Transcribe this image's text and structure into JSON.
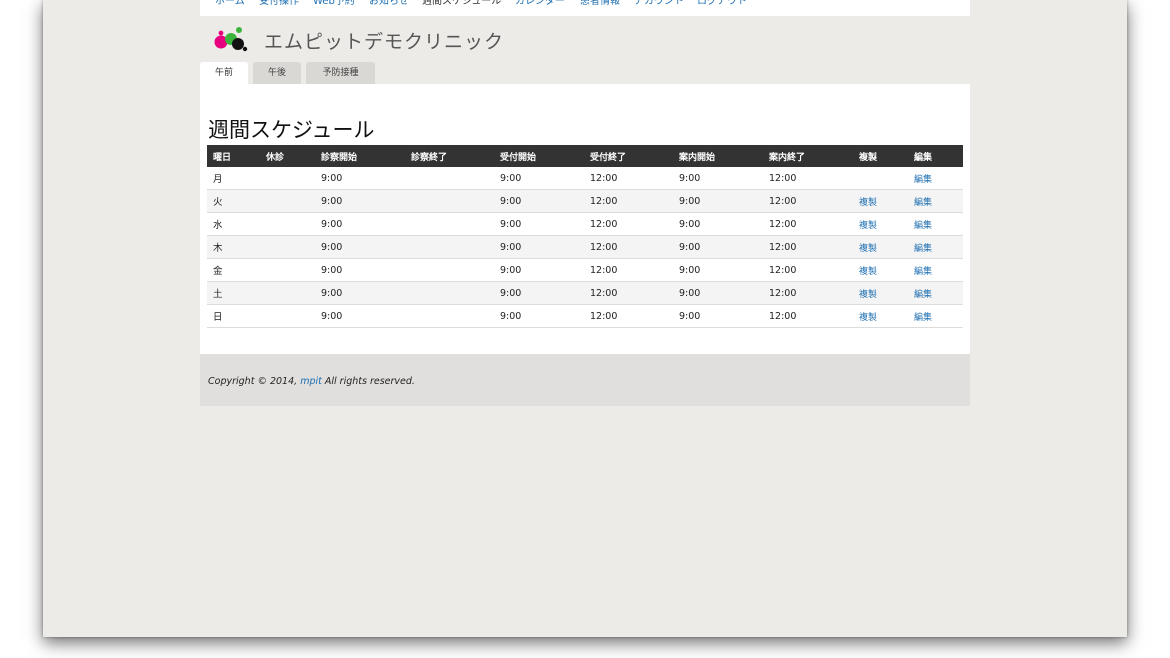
{
  "nav": {
    "items": [
      {
        "label": "ホーム",
        "current": false
      },
      {
        "label": "受付操作",
        "current": false
      },
      {
        "label": "Web予約",
        "current": false
      },
      {
        "label": "お知らせ",
        "current": false
      },
      {
        "label": "週間スケジュール",
        "current": true
      },
      {
        "label": "カレンダー",
        "current": false
      },
      {
        "label": "患者情報",
        "current": false
      },
      {
        "label": "アカウント",
        "current": false
      },
      {
        "label": "ログアウト",
        "current": false
      }
    ]
  },
  "header": {
    "brand": "エムピットデモクリニック"
  },
  "tabs": [
    {
      "label": "午前",
      "active": true
    },
    {
      "label": "午後",
      "active": false
    },
    {
      "label": "予防接種",
      "active": false
    }
  ],
  "page": {
    "title": "週間スケジュール"
  },
  "table": {
    "columns": [
      "曜日",
      "休診",
      "診察開始",
      "診察終了",
      "受付開始",
      "受付終了",
      "案内開始",
      "案内終了",
      "複製",
      "編集"
    ],
    "rows": [
      {
        "day": "月",
        "closed": "",
        "exam_start": "9:00",
        "exam_end": "",
        "rec_start": "9:00",
        "rec_end": "12:00",
        "guide_start": "9:00",
        "guide_end": "12:00",
        "copy": "",
        "edit": "編集"
      },
      {
        "day": "火",
        "closed": "",
        "exam_start": "9:00",
        "exam_end": "",
        "rec_start": "9:00",
        "rec_end": "12:00",
        "guide_start": "9:00",
        "guide_end": "12:00",
        "copy": "複製",
        "edit": "編集"
      },
      {
        "day": "水",
        "closed": "",
        "exam_start": "9:00",
        "exam_end": "",
        "rec_start": "9:00",
        "rec_end": "12:00",
        "guide_start": "9:00",
        "guide_end": "12:00",
        "copy": "複製",
        "edit": "編集"
      },
      {
        "day": "木",
        "closed": "",
        "exam_start": "9:00",
        "exam_end": "",
        "rec_start": "9:00",
        "rec_end": "12:00",
        "guide_start": "9:00",
        "guide_end": "12:00",
        "copy": "複製",
        "edit": "編集"
      },
      {
        "day": "金",
        "closed": "",
        "exam_start": "9:00",
        "exam_end": "",
        "rec_start": "9:00",
        "rec_end": "12:00",
        "guide_start": "9:00",
        "guide_end": "12:00",
        "copy": "複製",
        "edit": "編集"
      },
      {
        "day": "土",
        "closed": "",
        "exam_start": "9:00",
        "exam_end": "",
        "rec_start": "9:00",
        "rec_end": "12:00",
        "guide_start": "9:00",
        "guide_end": "12:00",
        "copy": "複製",
        "edit": "編集"
      },
      {
        "day": "日",
        "closed": "",
        "exam_start": "9:00",
        "exam_end": "",
        "rec_start": "9:00",
        "rec_end": "12:00",
        "guide_start": "9:00",
        "guide_end": "12:00",
        "copy": "複製",
        "edit": "編集"
      }
    ]
  },
  "footer": {
    "prefix": "Copyright © 2014, ",
    "link": "mpit",
    "suffix": " All rights reserved."
  },
  "colors": {
    "link": "#1e6fb2",
    "table_header": "#333333",
    "logo_pink": "#e6007e",
    "logo_green": "#3cb33c",
    "logo_black": "#111111"
  }
}
